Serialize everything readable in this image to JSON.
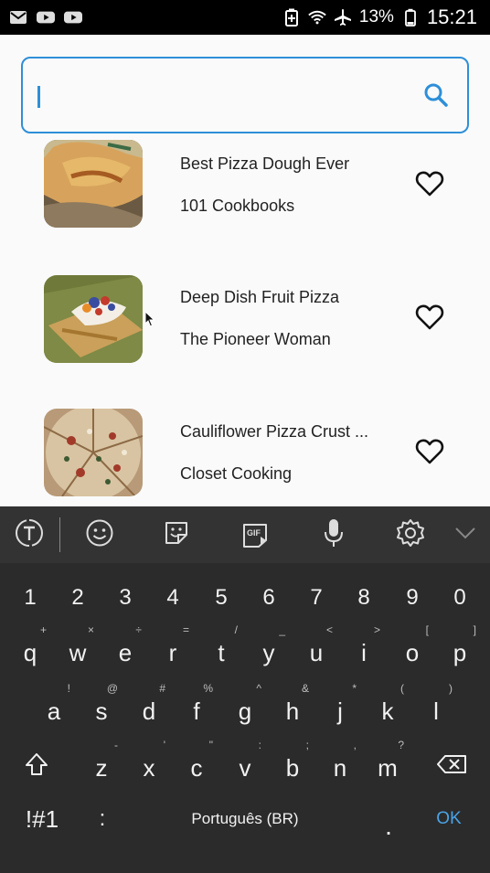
{
  "status_bar": {
    "left_icons": [
      "mail-icon",
      "youtube-icon",
      "youtube-icon"
    ],
    "right_icons": [
      "battery-saver-icon",
      "wifi-icon",
      "airplane-icon",
      "battery-icon"
    ],
    "battery_text": "13%",
    "time": "15:21"
  },
  "search": {
    "value": "",
    "placeholder": "",
    "icon": "search-icon",
    "accent_color": "#2e8fd8"
  },
  "recipes": [
    {
      "title": "Best Pizza Dough Ever",
      "source": "101 Cookbooks",
      "favorite": false
    },
    {
      "title": "Deep Dish Fruit Pizza",
      "source": "The Pioneer Woman",
      "favorite": false
    },
    {
      "title": "Cauliflower Pizza Crust ...",
      "source": "Closet Cooking",
      "favorite": false
    }
  ],
  "keyboard": {
    "toolbar": [
      "translate-icon",
      "emoji-icon",
      "sticker-icon",
      "gif-icon",
      "microphone-icon",
      "settings-icon",
      "collapse-icon"
    ],
    "gif_label": "GIF",
    "number_row": [
      "1",
      "2",
      "3",
      "4",
      "5",
      "6",
      "7",
      "8",
      "9",
      "0"
    ],
    "row1": {
      "keys": [
        "q",
        "w",
        "e",
        "r",
        "t",
        "y",
        "u",
        "i",
        "o",
        "p"
      ],
      "hints": [
        "+",
        "×",
        "÷",
        "=",
        "/",
        "_",
        "<",
        ">",
        "[",
        "]"
      ]
    },
    "row2": {
      "keys": [
        "a",
        "s",
        "d",
        "f",
        "g",
        "h",
        "j",
        "k",
        "l"
      ],
      "hints": [
        "!",
        "@",
        "#",
        "%",
        "^",
        "&",
        "*",
        "(",
        ")"
      ]
    },
    "row3": {
      "keys": [
        "z",
        "x",
        "c",
        "v",
        "b",
        "n",
        "m"
      ],
      "hints": [
        "-",
        "'",
        "\"",
        ":",
        ";",
        ",",
        "?"
      ]
    },
    "symbols_label": "!#1",
    "colon_label": ":",
    "space_label": "Português (BR)",
    "period_label": ".",
    "ok_label": "OK",
    "ok_color": "#4aa3e6"
  }
}
